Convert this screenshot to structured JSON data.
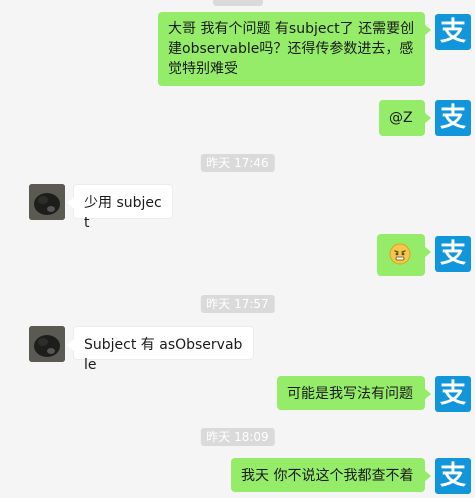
{
  "contacts": {
    "me": {
      "avatar_glyph": "支",
      "avatar_color": "#1296db"
    },
    "other": {
      "avatar_color": "#3b3d3a"
    }
  },
  "colors": {
    "bubble_mine": "#95ec69",
    "bubble_theirs": "#ffffff",
    "background": "#f5f5f5",
    "timestamp_bg": "#dadada"
  },
  "messages": {
    "m1": {
      "text_line1": "大哥 我有个问题 有subject了 还需要创",
      "text_line2": "建observable吗？还得传参数进去，感",
      "text_line3": "觉特别难受"
    },
    "m2": {
      "text": "@Z"
    },
    "t1": {
      "text": "昨天 17:46"
    },
    "m3": {
      "text": "少用 subject"
    },
    "m4": {
      "emoji": "grimace-emoji"
    },
    "t2": {
      "text": "昨天 17:57"
    },
    "m5": {
      "text": "Subject 有 asObservable"
    },
    "m6": {
      "text": "可能是我写法有问题"
    },
    "t3": {
      "text": "昨天 18:09"
    },
    "m7": {
      "text": "我天 你不说这个我都查不着"
    }
  }
}
